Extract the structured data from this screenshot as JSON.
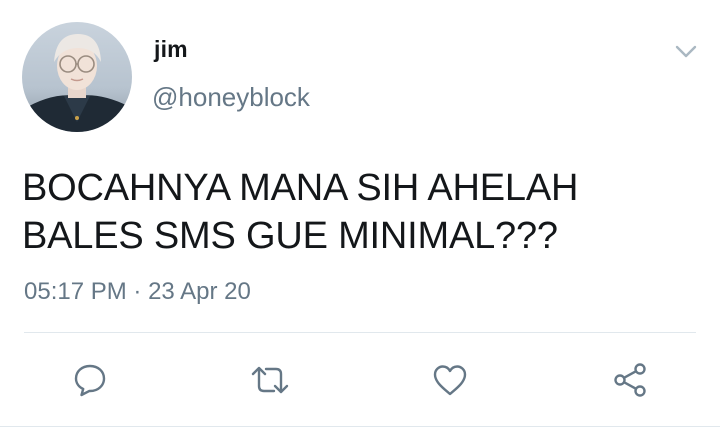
{
  "user": {
    "display_name": "jim",
    "handle": "@honeyblock"
  },
  "tweet": {
    "lines": [
      "BOCAHNYA MANA SIH AHELAH",
      "BALES SMS GUE MINIMAL???"
    ],
    "time": "05:17 PM",
    "separator": "·",
    "date": "23 Apr 20"
  },
  "icons": {
    "caret": "chevron-down-icon",
    "reply": "reply-icon",
    "retweet": "retweet-icon",
    "like": "heart-icon",
    "share": "share-icon"
  },
  "colors": {
    "text": "#14171a",
    "secondary": "#657786",
    "icon": "#657786",
    "divider": "#e1e8ed"
  }
}
